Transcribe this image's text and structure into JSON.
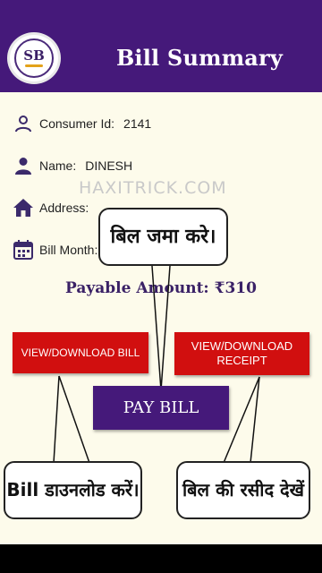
{
  "header": {
    "title": "Bill Summary",
    "logo_text": "SB"
  },
  "details": {
    "consumer_label": "Consumer Id:",
    "consumer_value": "2141",
    "name_label": "Name:",
    "name_value": "DINESH",
    "address_label": "Address:",
    "bill_month_label": "Bill Month:"
  },
  "watermark": "HAXITRICK.COM",
  "payable": "Payable Amount: ₹310",
  "buttons": {
    "view_bill": "VIEW/DOWNLOAD BILL",
    "view_receipt": "VIEW/DOWNLOAD RECEIPT",
    "pay_bill": "PAY BILL"
  },
  "callouts": {
    "pay": "बिल जमा करे।",
    "download": "Bill डाउनलोड करें।",
    "receipt": "बिल की रसीद देखें"
  },
  "colors": {
    "header": "#45197a",
    "background": "#fdfbeb",
    "red_button": "#d10f0f",
    "icon": "#3b2a6b"
  }
}
